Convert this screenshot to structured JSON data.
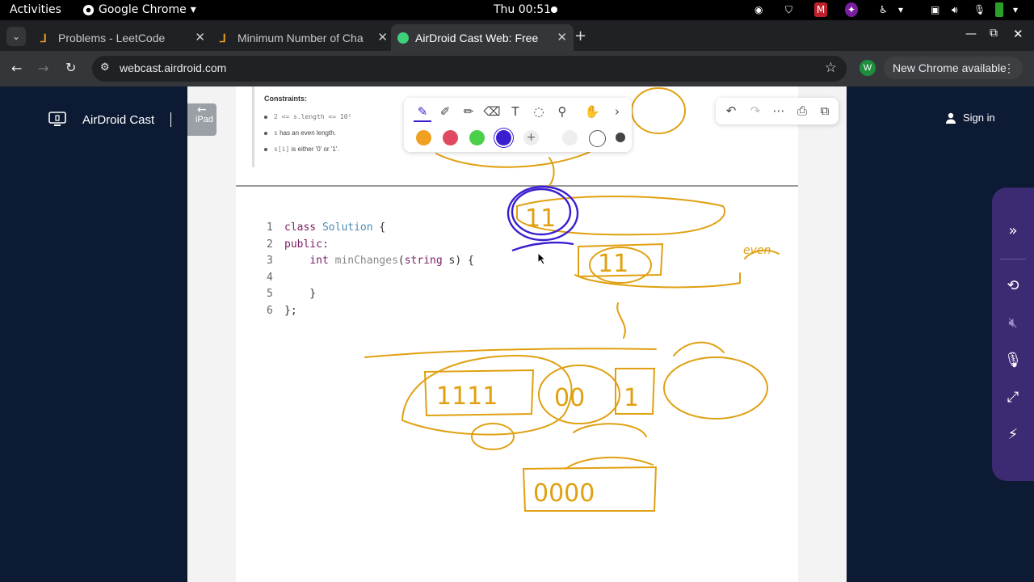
{
  "topbar": {
    "activities": "Activities",
    "app_name": "Google Chrome",
    "clock": "Thu 00:51"
  },
  "tabs": [
    {
      "label": "Problems - LeetCode",
      "active": false
    },
    {
      "label": "Minimum Number of Cha",
      "active": false
    },
    {
      "label": "AirDroid Cast Web: Free",
      "active": true
    }
  ],
  "omnibox": {
    "url": "webcast.airdroid.com"
  },
  "chrome": {
    "profile_initial": "W",
    "update_label": "New Chrome available"
  },
  "page": {
    "brand": "AirDroid Cast",
    "device_label": "iPad",
    "sign_in": "Sign in"
  },
  "problem": {
    "constraints_heading": "Constraints:",
    "constraint_1": "2 <= s.length <= 10⁵",
    "constraint_2_code": "s",
    "constraint_2_text": "has an even length.",
    "constraint_3_code": "s[i]",
    "constraint_3_text": "is either '0' or '1'."
  },
  "code_lines": [
    {
      "n": "1",
      "text": "class Solution {"
    },
    {
      "n": "2",
      "text": "public:"
    },
    {
      "n": "3",
      "text": "    int minChanges(string s) {"
    },
    {
      "n": "4",
      "text": ""
    },
    {
      "n": "5",
      "text": "    }"
    },
    {
      "n": "6",
      "text": "};"
    }
  ],
  "pen_colors": [
    "#f0a020",
    "#e04a60",
    "#4cd04c",
    "#3a1fd0"
  ],
  "ink_color": "#e0a010",
  "ink_annotation": "even"
}
